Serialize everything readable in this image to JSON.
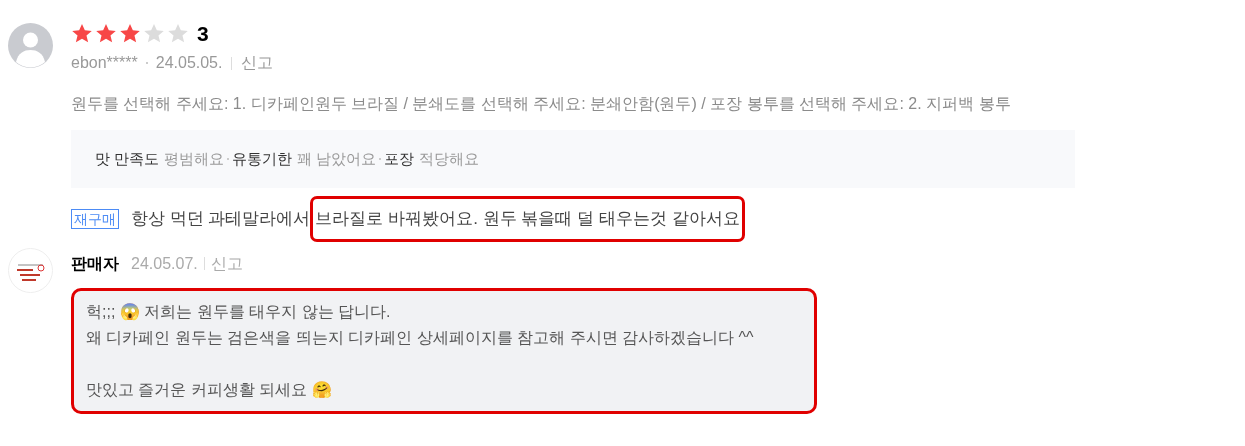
{
  "review": {
    "stars": 3,
    "rating": "3",
    "author": "ebon*****",
    "date": "24.05.05.",
    "report": "신고",
    "options": "원두를 선택해 주세요: 1. 디카페인원두 브라질 / 분쇄도를 선택해 주세요: 분쇄안함(원두) / 포장 봉투를 선택해 주세요: 2. 지퍼백 봉투",
    "attributes": [
      {
        "name": "맛 만족도",
        "value": "평범해요"
      },
      {
        "name": "유통기한",
        "value": "꽤 남았어요"
      },
      {
        "name": "포장",
        "value": "적당해요"
      }
    ],
    "badge": "재구매",
    "segments": [
      {
        "text": "항상 먹던 과테말라에서",
        "highlighted": false
      },
      {
        "text": "브라질로 바꿔봤어요. 원두 볶을때 덜 태우는것 같아서요",
        "highlighted": true
      }
    ]
  },
  "reply": {
    "author": "판매자",
    "date": "24.05.07.",
    "report": "신고",
    "highlighted": true,
    "lines": [
      "헉;;; 😱 저희는 원두를 태우지 않는 답니다.",
      "왜 디카페인 원두는 검은색을 띄는지 디카페인 상세페이지를 참고해 주시면 감사하겠습니다 ^^",
      "맛있고 즐거운 커피생활 되세요 🤗"
    ]
  }
}
